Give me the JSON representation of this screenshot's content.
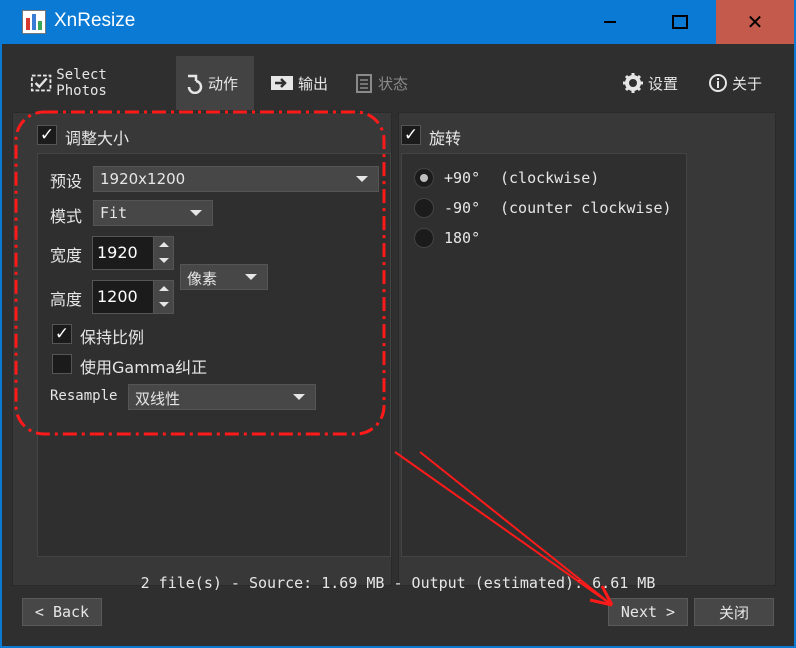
{
  "window": {
    "title": "XnResize"
  },
  "toolbar": {
    "tabs": [
      {
        "label": "Select Photos",
        "icon": "image-select-icon"
      },
      {
        "label": "动作",
        "icon": "rotate-action-icon"
      },
      {
        "label": "输出",
        "icon": "output-icon"
      },
      {
        "label": "状态",
        "icon": "status-clipboard-icon"
      }
    ],
    "settings_label": "设置",
    "about_label": "关于"
  },
  "resize": {
    "header": "调整大小",
    "enabled": true,
    "preset_label": "预设",
    "preset_value": "1920x1200",
    "mode_label": "模式",
    "mode_value": "Fit",
    "width_label": "宽度",
    "width_value": "1920",
    "height_label": "高度",
    "height_value": "1200",
    "unit_value": "像素",
    "keep_ratio_label": "保持比例",
    "keep_ratio_checked": true,
    "gamma_label": "使用Gamma纠正",
    "gamma_checked": false,
    "resample_label": "Resample",
    "resample_value": "双线性"
  },
  "rotate": {
    "header": "旋转",
    "enabled": true,
    "options": [
      {
        "angle": "+90°",
        "desc": "(clockwise)",
        "selected": true
      },
      {
        "angle": "-90°",
        "desc": "(counter clockwise)",
        "selected": false
      },
      {
        "angle": "180°",
        "desc": "",
        "selected": false
      }
    ]
  },
  "status": {
    "text": "2 file(s) - Source: 1.69 MB - Output (estimated): 6.61 MB"
  },
  "buttons": {
    "back": "< Back",
    "next": "Next >",
    "close": "关闭"
  },
  "colors": {
    "titlebar": "#0a7ad4",
    "close_button": "#c35a4c",
    "background": "#2f2f2f",
    "annotation_red": "#ff1a1a"
  }
}
